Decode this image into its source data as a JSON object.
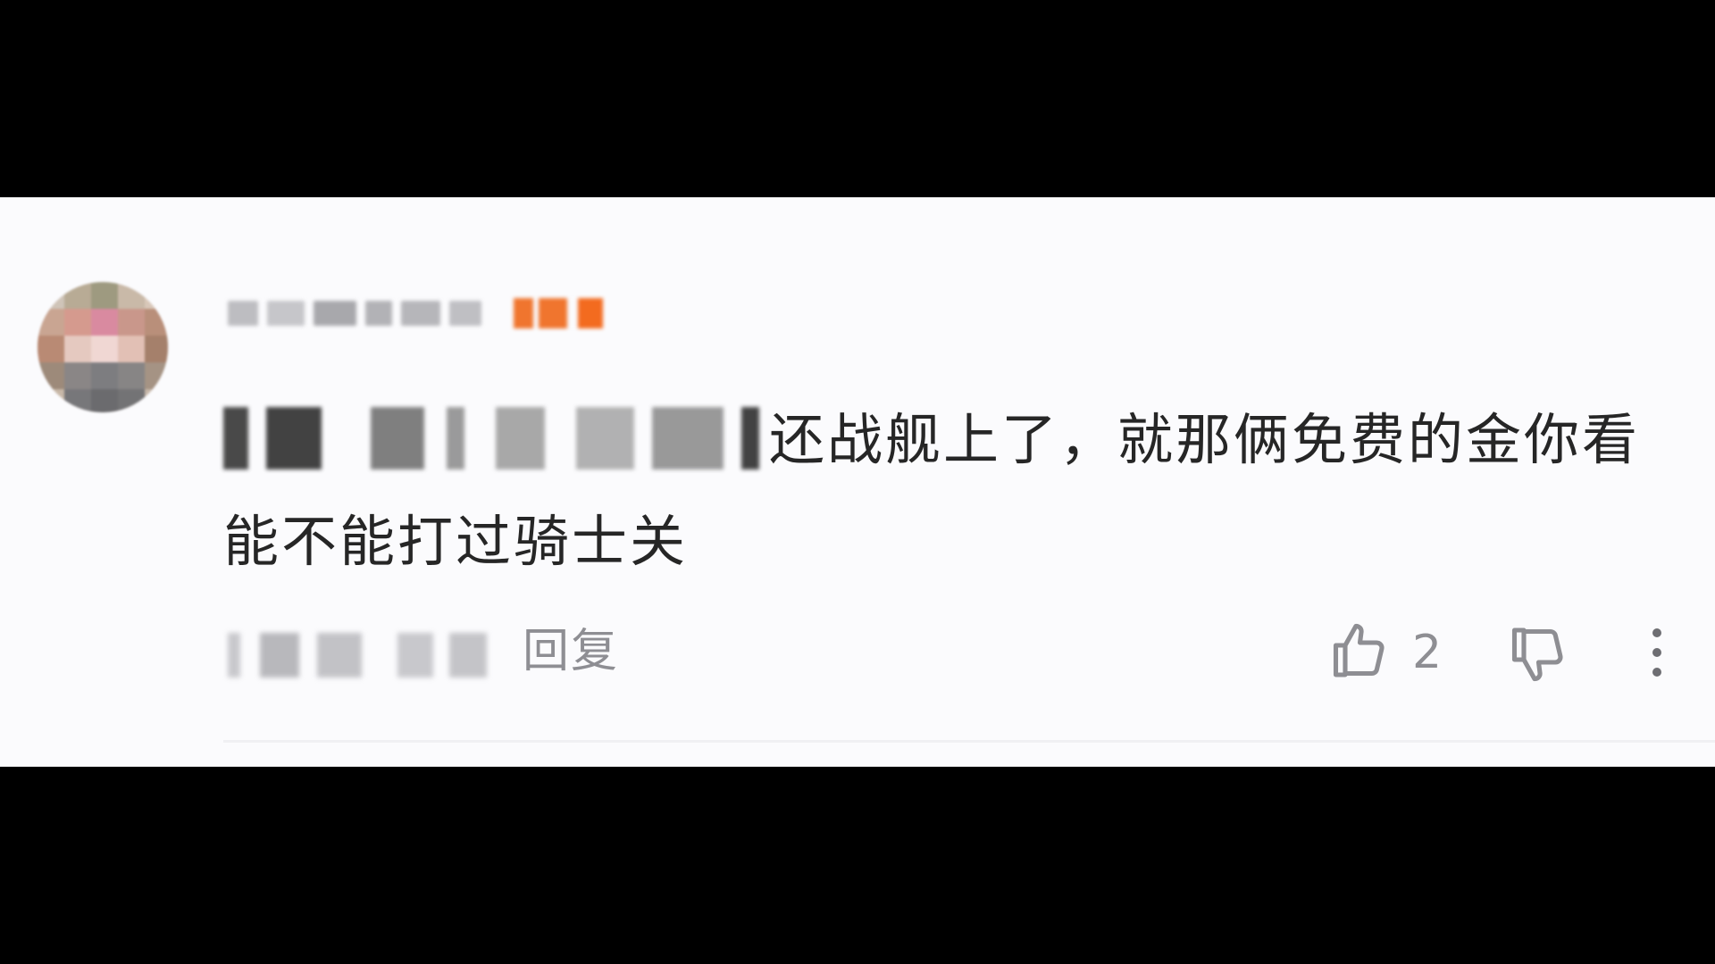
{
  "comment": {
    "text": "还战舰上了，就那俩免费的金你看能不能打过骑士关",
    "reply_label": "回复",
    "like_count": "2"
  },
  "icons": {
    "like": "thumbs-up-icon",
    "dislike": "thumbs-down-icon",
    "more": "vertical-ellipsis-icon"
  },
  "colors": {
    "letterbox": "#000000",
    "card_background": "#fbfbfd",
    "text_primary": "#262626",
    "text_secondary": "#8e8e93",
    "level_badge": "#f0752e"
  }
}
